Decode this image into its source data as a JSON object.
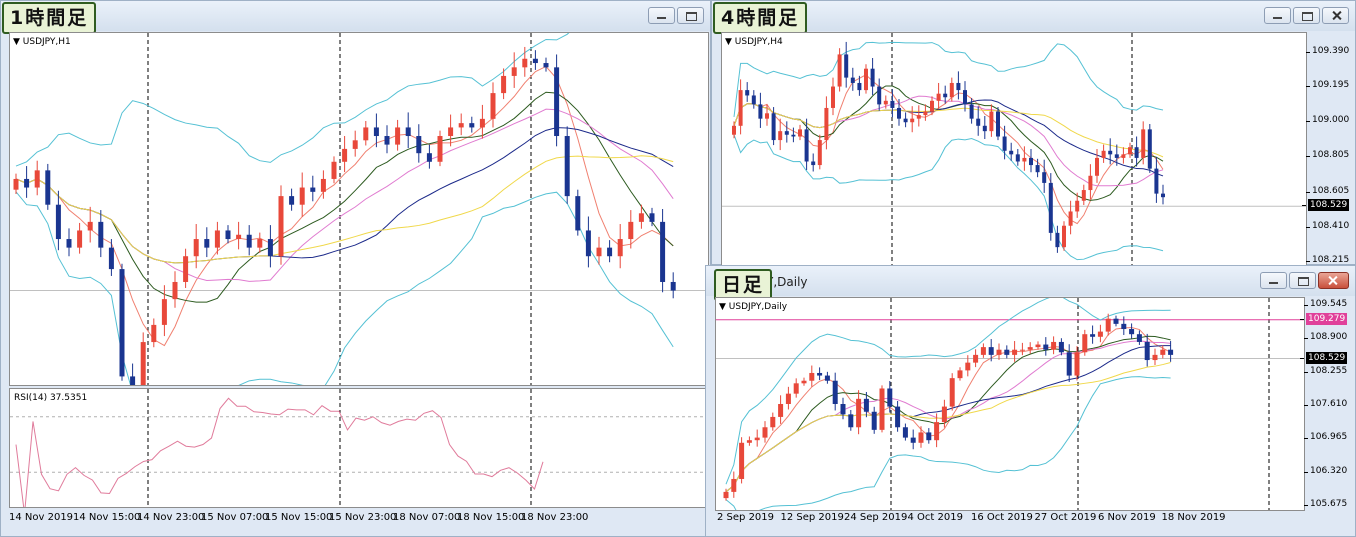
{
  "windows": {
    "h1": {
      "badge": "1時間足",
      "chart_label": "USDJPY,H1",
      "rsi_label": "RSI(14) 37.5351",
      "xlabels": [
        "14 Nov 2019",
        "14 Nov 15:00",
        "14 Nov 23:00",
        "15 Nov 07:00",
        "15 Nov 15:00",
        "15 Nov 23:00",
        "18 Nov 07:00",
        "18 Nov 15:00",
        "18 Nov 23:00"
      ]
    },
    "h4": {
      "badge": "4時間足",
      "chart_label": "USDJPY,H4",
      "ylabels": [
        "109.390",
        "109.195",
        "109.000",
        "108.805",
        "108.605",
        "108.410",
        "108.215"
      ],
      "price_tag": "108.529"
    },
    "d1": {
      "badge": "日足",
      "title_text": "Y,Daily",
      "chart_label": "USDJPY,Daily",
      "ylabels": [
        "109.545",
        "108.900",
        "108.255",
        "107.610",
        "106.965",
        "106.320",
        "105.675"
      ],
      "price_tag": "108.529",
      "level_tag": "109.279",
      "xlabels": [
        "2 Sep 2019",
        "12 Sep 2019",
        "24 Sep 2019",
        "4 Oct 2019",
        "16 Oct 2019",
        "27 Oct 2019",
        "6 Nov 2019",
        "18 Nov 2019"
      ]
    }
  },
  "chart_data": [
    {
      "type": "candlestick",
      "symbol": "USDJPY",
      "timeframe": "H1",
      "indicators": [
        "Bollinger Bands",
        "Moving Averages",
        "RSI(14)"
      ],
      "rsi_value": 37.5351,
      "x_tick_labels": [
        "14 Nov 2019",
        "14 Nov 15:00",
        "14 Nov 23:00",
        "15 Nov 07:00",
        "15 Nov 15:00",
        "15 Nov 23:00",
        "18 Nov 07:00",
        "18 Nov 15:00",
        "18 Nov 23:00"
      ],
      "y_range": [
        108.35,
        109.05
      ],
      "closes": [
        108.76,
        108.74,
        108.78,
        108.7,
        108.62,
        108.6,
        108.64,
        108.66,
        108.6,
        108.55,
        108.3,
        108.28,
        108.38,
        108.42,
        108.48,
        108.52,
        108.58,
        108.62,
        108.6,
        108.64,
        108.62,
        108.63,
        108.6,
        108.62,
        108.58,
        108.72,
        108.7,
        108.74,
        108.73,
        108.76,
        108.8,
        108.83,
        108.85,
        108.88,
        108.86,
        108.84,
        108.88,
        108.86,
        108.82,
        108.8,
        108.86,
        108.88,
        108.89,
        108.88,
        108.9,
        108.96,
        109.0,
        109.02,
        109.04,
        109.03,
        109.02,
        108.86,
        108.72,
        108.64,
        108.58,
        108.6,
        108.58,
        108.62,
        108.66,
        108.68,
        108.66,
        108.52,
        108.5
      ]
    },
    {
      "type": "candlestick",
      "symbol": "USDJPY",
      "timeframe": "H4",
      "indicators": [
        "Bollinger Bands",
        "Moving Averages"
      ],
      "y_tick_labels": [
        109.39,
        109.195,
        109.0,
        108.805,
        108.605,
        108.41,
        108.215
      ],
      "last_price": 108.529,
      "closes": [
        108.98,
        109.18,
        109.15,
        109.1,
        109.02,
        109.05,
        108.9,
        108.95,
        108.93,
        108.92,
        108.96,
        108.78,
        108.76,
        108.9,
        109.08,
        109.2,
        109.38,
        109.25,
        109.22,
        109.18,
        109.3,
        109.2,
        109.1,
        109.12,
        109.08,
        109.02,
        109.0,
        109.02,
        109.04,
        109.06,
        109.12,
        109.16,
        109.14,
        109.22,
        109.18,
        109.1,
        109.02,
        108.98,
        108.95,
        109.06,
        108.92,
        108.84,
        108.82,
        108.78,
        108.8,
        108.76,
        108.72,
        108.66,
        108.38,
        108.3,
        108.42,
        108.5,
        108.56,
        108.62,
        108.7,
        108.8,
        108.84,
        108.82,
        108.8,
        108.82,
        108.86,
        108.8,
        108.96,
        108.74,
        108.6,
        108.58
      ]
    },
    {
      "type": "candlestick",
      "symbol": "USDJPY",
      "timeframe": "Daily",
      "indicators": [
        "Bollinger Bands",
        "Moving Averages"
      ],
      "y_tick_labels": [
        109.545,
        108.9,
        108.255,
        107.61,
        106.965,
        106.32,
        105.675
      ],
      "last_price": 108.529,
      "horizontal_level": 109.279,
      "x_tick_labels": [
        "2 Sep 2019",
        "12 Sep 2019",
        "24 Sep 2019",
        "4 Oct 2019",
        "16 Oct 2019",
        "27 Oct 2019",
        "6 Nov 2019",
        "18 Nov 2019"
      ],
      "closes": [
        105.95,
        106.2,
        106.9,
        106.95,
        107.0,
        107.2,
        107.4,
        107.65,
        107.85,
        108.05,
        108.1,
        108.25,
        108.2,
        108.1,
        107.65,
        107.45,
        107.2,
        107.75,
        107.5,
        107.15,
        107.95,
        107.6,
        107.2,
        107.0,
        106.9,
        107.1,
        106.95,
        107.3,
        107.6,
        108.15,
        108.3,
        108.45,
        108.6,
        108.75,
        108.6,
        108.7,
        108.6,
        108.7,
        108.7,
        108.75,
        108.8,
        108.7,
        108.85,
        108.65,
        108.2,
        108.65,
        109.0,
        108.95,
        109.05,
        109.3,
        109.2,
        109.1,
        109.0,
        108.85,
        108.5,
        108.6,
        108.7,
        108.6
      ]
    }
  ]
}
